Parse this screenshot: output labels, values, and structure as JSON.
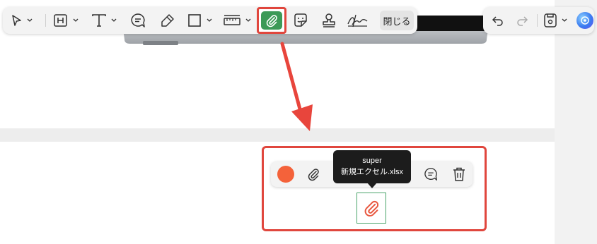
{
  "toolbar": {
    "close_label": "閉じる",
    "tools": [
      {
        "icon": "select-arrow-icon"
      },
      {
        "icon": "heading-icon",
        "glyph": "H"
      },
      {
        "icon": "text-icon",
        "glyph": "T"
      },
      {
        "icon": "comment-icon"
      },
      {
        "icon": "highlighter-icon"
      },
      {
        "icon": "rectangle-icon"
      },
      {
        "icon": "measure-icon"
      },
      {
        "icon": "attachment-icon",
        "active": true
      },
      {
        "icon": "sticker-icon"
      },
      {
        "icon": "stamp-icon"
      },
      {
        "icon": "signature-icon"
      }
    ],
    "accent": "#3c9a57",
    "highlight_color": "#e0463d"
  },
  "toolbar_right": {
    "tools": [
      {
        "icon": "undo-icon"
      },
      {
        "icon": "redo-icon"
      },
      {
        "icon": "save-icon"
      },
      {
        "icon": "ai-assistant-icon"
      }
    ]
  },
  "annotation_toolbar": {
    "color": "#f4623a",
    "tools": [
      {
        "icon": "color-picker-icon"
      },
      {
        "icon": "attachment-icon"
      },
      {
        "icon": "comment-icon"
      },
      {
        "icon": "delete-icon"
      }
    ]
  },
  "tooltip": {
    "line1": "super",
    "line2": "新規エクセル.xlsx"
  },
  "annotation": {
    "icon": "paperclip-icon",
    "color": "#e8573f"
  }
}
